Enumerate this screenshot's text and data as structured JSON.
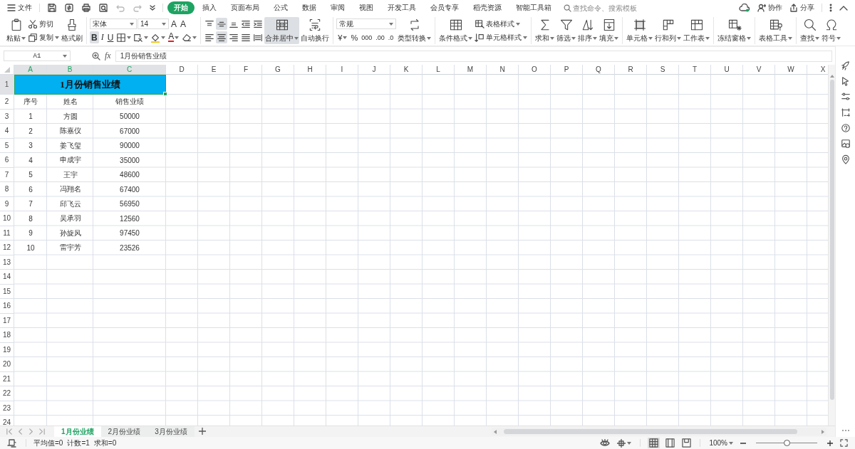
{
  "menu": {
    "file": "文件",
    "tabs": [
      {
        "label": "开始",
        "selected": true
      },
      {
        "label": "插入",
        "selected": false
      },
      {
        "label": "页面布局",
        "selected": false
      },
      {
        "label": "公式",
        "selected": false
      },
      {
        "label": "数据",
        "selected": false
      },
      {
        "label": "审阅",
        "selected": false
      },
      {
        "label": "视图",
        "selected": false
      },
      {
        "label": "开发工具",
        "selected": false
      },
      {
        "label": "会员专享",
        "selected": false
      },
      {
        "label": "稻壳资源",
        "selected": false
      },
      {
        "label": "智能工具箱",
        "selected": false
      }
    ],
    "search": {
      "placeholder": "查找命令、搜索模板"
    },
    "actions": [
      "协作",
      "分享"
    ]
  },
  "ribbon": [
    {
      "items": [
        {
          "kind": "large",
          "label": "粘贴",
          "menu": true,
          "on": false
        },
        {
          "kind": "stack",
          "items": [
            {
              "kind": "small",
              "label": "剪切",
              "menu": false,
              "on": false
            },
            {
              "kind": "small",
              "label": "复制",
              "menu": true,
              "on": false
            }
          ]
        },
        {
          "kind": "large",
          "label": "格式刷",
          "menu": false,
          "on": false
        }
      ]
    },
    {
      "items": [
        {
          "kind": "rows",
          "lines": [
            {
              "items": [
                {
                  "kind": "font-name",
                  "value": "宋体"
                },
                {
                  "kind": "font-size",
                  "value": "14"
                },
                {
                  "kind": "glyph",
                  "label": "A",
                  "on": false,
                  "menu": false
                },
                {
                  "kind": "glyph",
                  "label": "A",
                  "on": false,
                  "menu": false
                }
              ]
            },
            {
              "items": [
                {
                  "kind": "glyph",
                  "label": "B",
                  "on": true,
                  "menu": false
                },
                {
                  "kind": "glyph",
                  "label": "I",
                  "on": false,
                  "menu": false
                },
                {
                  "kind": "glyph",
                  "label": "U",
                  "on": false,
                  "menu": false
                },
                {
                  "kind": "tool",
                  "on": false,
                  "menu": true
                },
                {
                  "kind": "tool",
                  "on": false,
                  "menu": true
                },
                {
                  "kind": "tool",
                  "on": false,
                  "menu": true
                },
                {
                  "kind": "glyph",
                  "label": "A",
                  "on": false,
                  "menu": true
                },
                {
                  "kind": "tool",
                  "on": false,
                  "menu": true
                }
              ]
            }
          ]
        }
      ]
    },
    {
      "items": [
        {
          "kind": "rows",
          "lines": [
            {
              "items": [
                {
                  "kind": "tool",
                  "on": false,
                  "menu": false
                },
                {
                  "kind": "tool",
                  "on": true,
                  "menu": false
                },
                {
                  "kind": "tool",
                  "on": false,
                  "menu": false
                },
                {
                  "kind": "tool",
                  "on": false,
                  "menu": false
                },
                {
                  "kind": "tool",
                  "on": false,
                  "menu": false
                }
              ]
            },
            {
              "items": [
                {
                  "kind": "tool",
                  "on": false,
                  "menu": false
                },
                {
                  "kind": "tool",
                  "on": true,
                  "menu": false
                },
                {
                  "kind": "tool",
                  "on": false,
                  "menu": false
                },
                {
                  "kind": "tool",
                  "on": false,
                  "menu": false
                },
                {
                  "kind": "tool",
                  "on": false,
                  "menu": false
                }
              ]
            }
          ]
        },
        {
          "kind": "large",
          "label": "合并居中",
          "menu": true,
          "on": true
        },
        {
          "kind": "large",
          "label": "自动换行",
          "menu": false,
          "on": false
        }
      ]
    },
    {
      "items": [
        {
          "kind": "rows",
          "lines": [
            {
              "items": [
                {
                  "kind": "number-format",
                  "value": "常规"
                }
              ]
            },
            {
              "items": [
                {
                  "kind": "glyph",
                  "label": "¥",
                  "on": false,
                  "menu": true
                },
                {
                  "kind": "glyph",
                  "label": "%",
                  "on": false,
                  "menu": false
                },
                {
                  "kind": "glyph",
                  "label": "000",
                  "on": false,
                  "menu": false
                },
                {
                  "kind": "glyph",
                  "label": ".00",
                  "on": false,
                  "menu": false
                },
                {
                  "kind": "glyph",
                  "label": ".0",
                  "on": false,
                  "menu": false
                }
              ]
            }
          ]
        },
        {
          "kind": "large",
          "label": "类型转换",
          "menu": true,
          "on": false
        }
      ]
    },
    {
      "items": [
        {
          "kind": "large",
          "label": "条件格式",
          "menu": true,
          "on": false
        },
        {
          "kind": "stack",
          "items": [
            {
              "kind": "small",
              "label": "表格样式",
              "menu": true,
              "on": false
            },
            {
              "kind": "small",
              "label": "单元格样式",
              "menu": true,
              "on": false
            }
          ]
        }
      ]
    },
    {
      "items": [
        {
          "kind": "large",
          "label": "求和",
          "menu": true,
          "on": false
        },
        {
          "kind": "large",
          "label": "筛选",
          "menu": true,
          "on": false
        },
        {
          "kind": "large",
          "label": "排序",
          "menu": true,
          "on": false
        },
        {
          "kind": "large",
          "label": "填充",
          "menu": true,
          "on": false
        }
      ]
    },
    {
      "items": [
        {
          "kind": "large",
          "label": "单元格",
          "menu": true,
          "on": false
        },
        {
          "kind": "large",
          "label": "行和列",
          "menu": true,
          "on": false
        },
        {
          "kind": "large",
          "label": "工作表",
          "menu": true,
          "on": false
        }
      ]
    },
    {
      "items": [
        {
          "kind": "large",
          "label": "冻结窗格",
          "menu": true,
          "on": false
        }
      ]
    },
    {
      "items": [
        {
          "kind": "large",
          "label": "表格工具",
          "menu": true,
          "on": false
        }
      ]
    },
    {
      "items": [
        {
          "kind": "large",
          "label": "查找",
          "menu": true,
          "on": false
        },
        {
          "kind": "large",
          "label": "符号",
          "menu": true,
          "on": false
        }
      ]
    }
  ],
  "formula_bar": {
    "name_box": "A1",
    "fx": "fx",
    "formula": "1月份销售业绩"
  },
  "sheet": {
    "columns": [
      {
        "label": "A",
        "selected": true
      },
      {
        "label": "B",
        "selected": true
      },
      {
        "label": "C",
        "selected": true
      },
      {
        "label": "D",
        "selected": false
      },
      {
        "label": "E",
        "selected": false
      },
      {
        "label": "F",
        "selected": false
      },
      {
        "label": "G",
        "selected": false
      },
      {
        "label": "H",
        "selected": false
      },
      {
        "label": "I",
        "selected": false
      },
      {
        "label": "J",
        "selected": false
      },
      {
        "label": "K",
        "selected": false
      },
      {
        "label": "L",
        "selected": false
      },
      {
        "label": "M",
        "selected": false
      },
      {
        "label": "N",
        "selected": false
      },
      {
        "label": "O",
        "selected": false
      },
      {
        "label": "P",
        "selected": false
      },
      {
        "label": "Q",
        "selected": false
      },
      {
        "label": "R",
        "selected": false
      },
      {
        "label": "S",
        "selected": false
      },
      {
        "label": "T",
        "selected": false
      },
      {
        "label": "U",
        "selected": false
      },
      {
        "label": "V",
        "selected": false
      },
      {
        "label": "W",
        "selected": false
      },
      {
        "label": "X",
        "selected": false
      }
    ],
    "rows": [
      {
        "label": "1",
        "selected": true
      },
      {
        "label": "2",
        "selected": false
      },
      {
        "label": "3",
        "selected": false
      },
      {
        "label": "4",
        "selected": false
      },
      {
        "label": "5",
        "selected": false
      },
      {
        "label": "6",
        "selected": false
      },
      {
        "label": "7",
        "selected": false
      },
      {
        "label": "8",
        "selected": false
      },
      {
        "label": "9",
        "selected": false
      },
      {
        "label": "10",
        "selected": false
      },
      {
        "label": "11",
        "selected": false
      },
      {
        "label": "12",
        "selected": false
      },
      {
        "label": "13",
        "selected": false
      },
      {
        "label": "14",
        "selected": false
      },
      {
        "label": "15",
        "selected": false
      },
      {
        "label": "16",
        "selected": false
      },
      {
        "label": "17",
        "selected": false
      },
      {
        "label": "18",
        "selected": false
      },
      {
        "label": "19",
        "selected": false
      },
      {
        "label": "20",
        "selected": false
      },
      {
        "label": "21",
        "selected": false
      },
      {
        "label": "22",
        "selected": false
      },
      {
        "label": "23",
        "selected": false
      },
      {
        "label": "24",
        "selected": false
      }
    ],
    "title": "1月份销售业绩",
    "header": [
      "序号",
      "姓名",
      "销售业绩"
    ],
    "records": [
      [
        "1",
        "方圆",
        "50000"
      ],
      [
        "2",
        "陈嘉仪",
        "67000"
      ],
      [
        "3",
        "姜飞玺",
        "90000"
      ],
      [
        "4",
        "申成宇",
        "35000"
      ],
      [
        "5",
        "王宇",
        "48600"
      ],
      [
        "6",
        "冯翔名",
        "67400"
      ],
      [
        "7",
        "邱飞云",
        "56950"
      ],
      [
        "8",
        "吴承羽",
        "12560"
      ],
      [
        "9",
        "孙旋风",
        "97450"
      ],
      [
        "10",
        "雷宇芳",
        "23526"
      ]
    ]
  },
  "sheet_tabs": [
    {
      "label": "1月份业绩",
      "selected": true
    },
    {
      "label": "2月份业绩",
      "selected": false
    },
    {
      "label": "3月份业绩",
      "selected": false
    }
  ],
  "status": {
    "stats": [
      "平均值=0",
      "计数=1",
      "求和=0"
    ],
    "zoom": "100%",
    "zoom_slider": {
      "level": 0.5
    },
    "views": [
      {
        "selected": true
      },
      {
        "selected": false
      },
      {
        "selected": false
      }
    ]
  }
}
